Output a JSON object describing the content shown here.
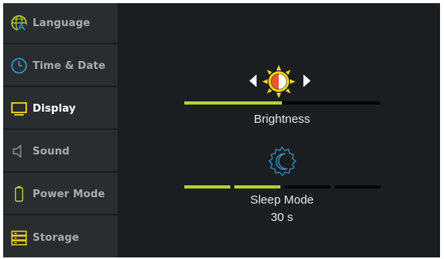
{
  "colors": {
    "background": "#1b1e21",
    "sidebar": "#2a2d30",
    "accent": "#b8d332",
    "sun_yellow": "#f0d21a",
    "sun_orange": "#e8582a",
    "moon_blue": "#2f90bf",
    "track": "#050505"
  },
  "sidebar": {
    "items": [
      {
        "label": "Language",
        "icon": "globe-icon",
        "active": false
      },
      {
        "label": "Time & Date",
        "icon": "clock-icon",
        "active": false
      },
      {
        "label": "Display",
        "icon": "monitor-icon",
        "active": true
      },
      {
        "label": "Sound",
        "icon": "speaker-icon",
        "active": false
      },
      {
        "label": "Power Mode",
        "icon": "battery-icon",
        "active": false
      },
      {
        "label": "Storage",
        "icon": "storage-icon",
        "active": false
      }
    ]
  },
  "main": {
    "brightness": {
      "label": "Brightness",
      "icon": "brightness-icon",
      "level": 0.5
    },
    "sleep_mode": {
      "label": "Sleep Mode",
      "value": "30 s",
      "icon": "moon-icon",
      "segments_total": 4,
      "segments_filled": 2
    }
  }
}
